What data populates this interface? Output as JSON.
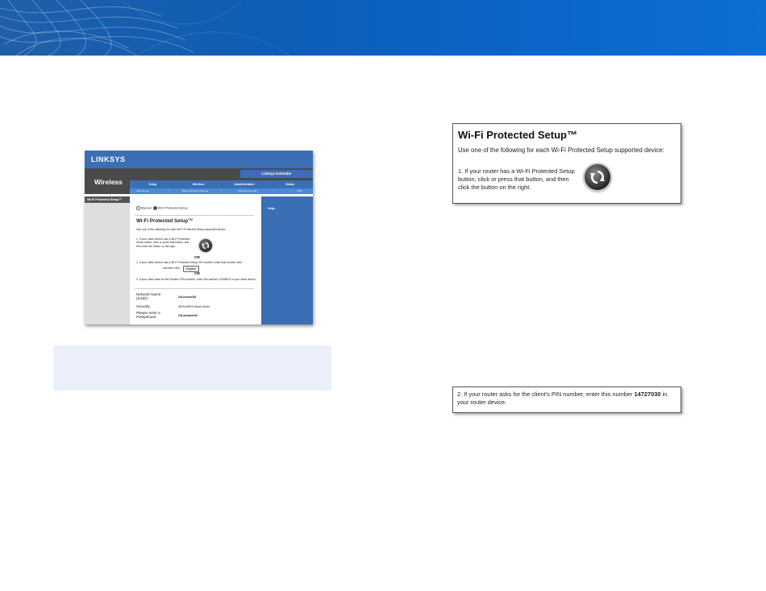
{
  "left_screenshot": {
    "brand": "LINKSYS",
    "section": "Wireless",
    "extender_label": "Linksys Extender",
    "tabs": [
      "Setup",
      "Wireless",
      "Administration",
      "Status"
    ],
    "subtabs": [
      "Site Survey",
      "|",
      "Basic Wireless Settings",
      "|",
      "Wireless Security",
      "|",
      "WPS"
    ],
    "sidebar_label": "Wi-Fi Protected Setup™",
    "help_label": "Help...",
    "mode_manual": "Manual",
    "mode_wps": "Wi-Fi Protected Setup",
    "heading": "Wi-Fi Protected Setup™",
    "intro": "Use one of the following for each Wi-Fi Protected Setup supported device:",
    "step1": "1. If your client device has a Wi-Fi Protected Setup button, click or press that button, and then click the button on the right.",
    "or1": "OR",
    "step2": "2. If your client device has a Wi-Fi Protected Setup PIN number, enter that number here",
    "step2_tail": "and then click",
    "register_button": "Register",
    "or2": "OR",
    "step3": "3. If your client asks for the Router's PIN number, enter this number 12345670 in your client device.",
    "network_name_label": "Network Name (SSID):",
    "network_name_value": "24LinobeeS8",
    "security_label": "Security:",
    "security_value": "WPA2/WPA Mixed Mode",
    "passphrase_label": "Please enter a Passphrase:",
    "passphrase_value": "23Lamiable38"
  },
  "crop_top": {
    "title": "Wi-Fi Protected Setup™",
    "intro": "Use one of the following for each Wi-Fi Protected Setup supported device:",
    "step1": "1. If your router has a Wi-Fi Protected Setup button, click or press that button, and then click the button on the right."
  },
  "crop_bottom": {
    "text_before": "2. If your router asks for the client's PIN number, enter this number ",
    "pin": "14727030",
    "text_after": " in your router device."
  },
  "colors": {
    "banner": "#0e5db6",
    "linksys_blue": "#3a6fb5",
    "info_box": "#ebf0fa"
  }
}
